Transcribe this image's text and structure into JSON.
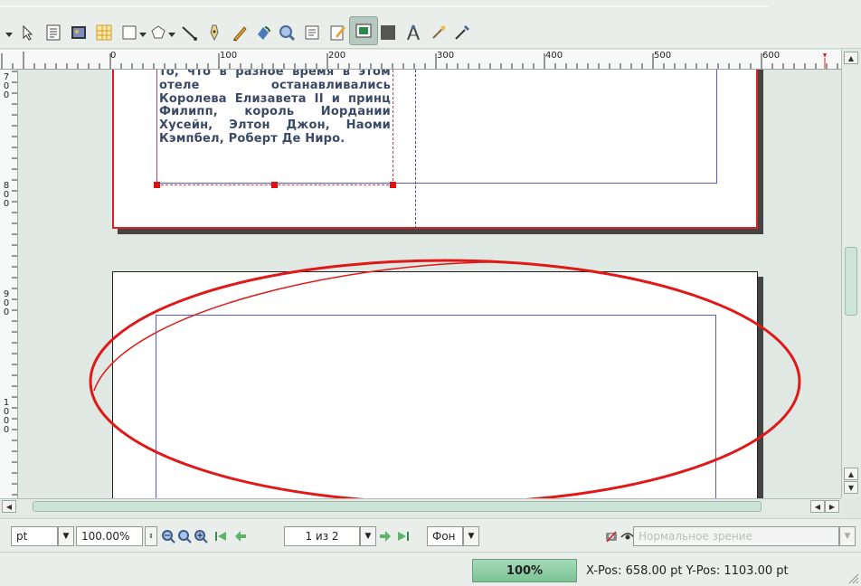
{
  "toolbar": {
    "icons": [
      "dropdown-arrow",
      "select-arrow-icon",
      "text-frame-icon",
      "image-frame-icon",
      "table-icon",
      "shape-icon",
      "polygon-icon",
      "line-icon",
      "bezier-icon",
      "freehand-icon",
      "rotate-icon",
      "zoom-icon",
      "edit-text-icon",
      "edit-content-icon",
      "link-frames-icon",
      "unlink-frames-icon",
      "measure-icon",
      "copy-properties-icon",
      "eyedropper-icon"
    ]
  },
  "ruler": {
    "h_labels": [
      "0",
      "100",
      "200",
      "300",
      "400",
      "500",
      "600"
    ],
    "v_labels": [
      [
        "7",
        "0",
        "0"
      ],
      [
        "8",
        "0",
        "0"
      ],
      [
        "9",
        "0",
        "0"
      ],
      [
        "1",
        "0",
        "0",
        "0"
      ]
    ]
  },
  "document": {
    "text": "то, что в разное время в этом отеле останавливались Королева Елизавета II и принц Филипп, король Иордании Хусейн, Элтон Джон, Наоми Кэмпбел, Роберт Де Ниро."
  },
  "bottombar": {
    "unit": "pt",
    "zoom": "100.00%",
    "page": "1 из 2",
    "layer": "Фон",
    "view_mode_placeholder": "Нормальное зрение"
  },
  "status": {
    "zoom": "100%",
    "position": "X-Pos: 658.00 pt   Y-Pos: 1103.00 pt"
  },
  "colors": {
    "accent_red": "#e02020",
    "margin_blue": "#5a5ad0",
    "zoom_green": "#8fcea5"
  }
}
